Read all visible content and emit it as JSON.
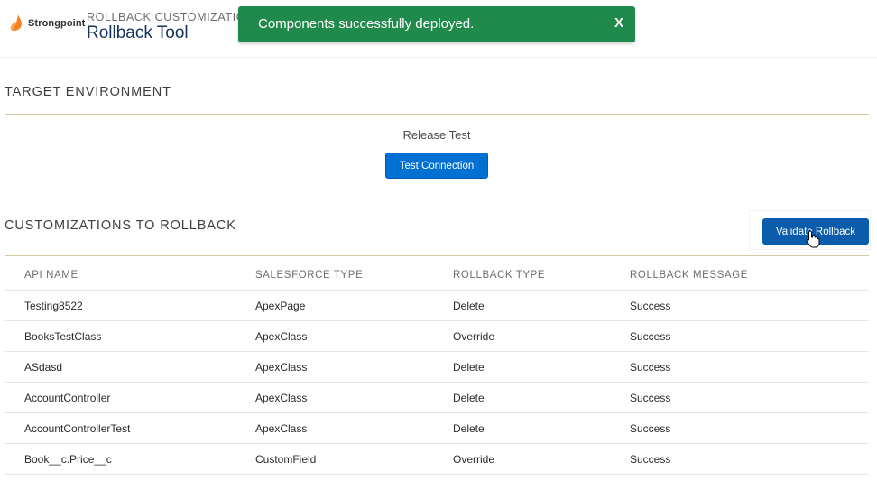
{
  "header": {
    "logo_text": "Strongpoint",
    "subtitle": "ROLLBACK CUSTOMIZATION",
    "title": "Rollback Tool"
  },
  "toast": {
    "message": "Components successfully deployed.",
    "close_label": "X",
    "color": "#1f8a4c"
  },
  "target": {
    "section_title": "TARGET ENVIRONMENT",
    "environment_name": "Release Test",
    "test_button": "Test Connection"
  },
  "customizations": {
    "section_title": "CUSTOMIZATIONS TO ROLLBACK",
    "validate_button": "Validate Rollback",
    "columns": [
      "API NAME",
      "SALESFORCE TYPE",
      "ROLLBACK TYPE",
      "ROLLBACK MESSAGE"
    ],
    "rows": [
      [
        "Testing8522",
        "ApexPage",
        "Delete",
        "Success"
      ],
      [
        "BooksTestClass",
        "ApexClass",
        "Override",
        "Success"
      ],
      [
        "ASdasd",
        "ApexClass",
        "Delete",
        "Success"
      ],
      [
        "AccountController",
        "ApexClass",
        "Delete",
        "Success"
      ],
      [
        "AccountControllerTest",
        "ApexClass",
        "Delete",
        "Success"
      ],
      [
        "Book__c.Price__c",
        "CustomField",
        "Override",
        "Success"
      ]
    ]
  },
  "colors": {
    "primary_button": "#0070d2",
    "accent_rule": "#d8c9a0"
  },
  "icons": {
    "logo": "strongpoint-flame-icon",
    "cursor": "hand-pointer-icon"
  }
}
